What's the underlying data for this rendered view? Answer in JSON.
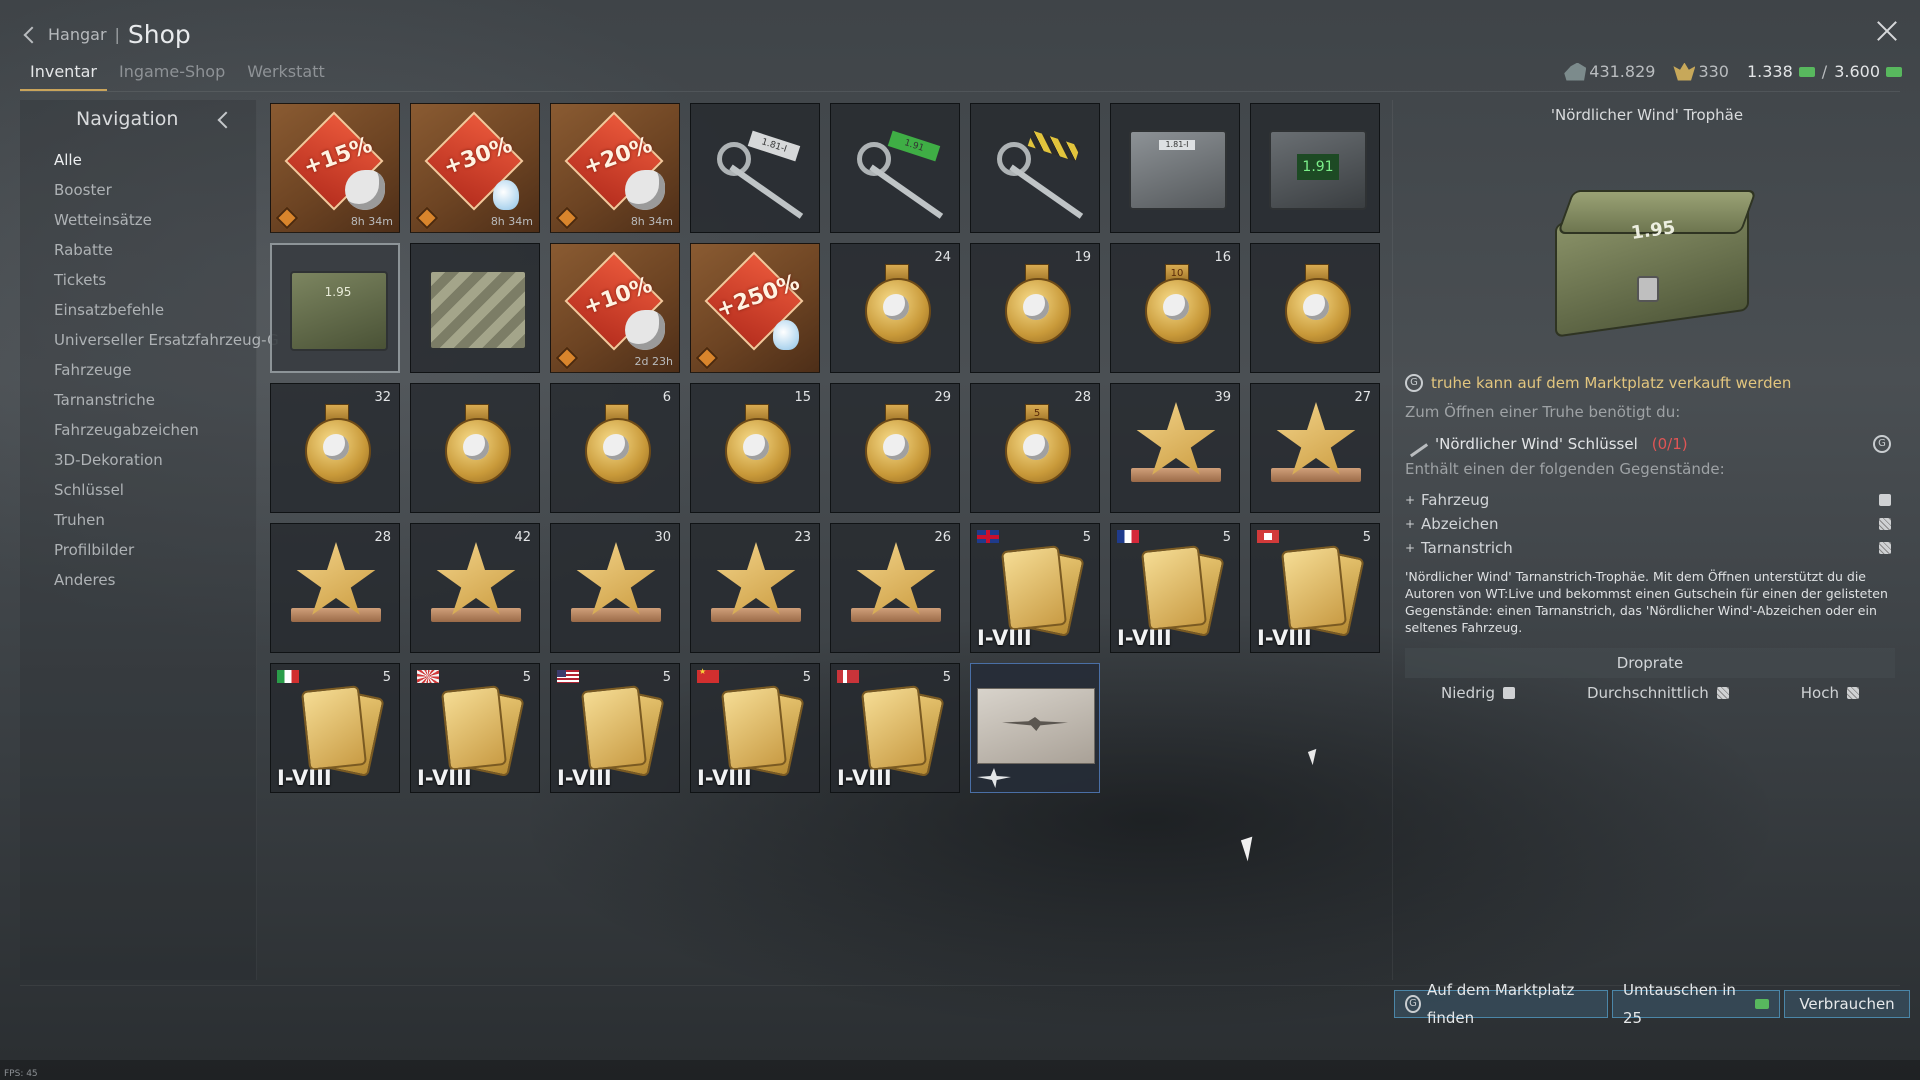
{
  "header": {
    "back_label": "Hangar",
    "separator": "|",
    "title": "Shop",
    "tabs": [
      {
        "label": "Inventar",
        "active": true
      },
      {
        "label": "Ingame-Shop",
        "active": false
      },
      {
        "label": "Werkstatt",
        "active": false
      }
    ]
  },
  "currency": {
    "silver_lions": "431.829",
    "eagles": "330",
    "ge_current": "1.338",
    "ge_separator": "/",
    "ge_total": "3.600"
  },
  "navigation": {
    "title": "Navigation",
    "items": [
      "Alle",
      "Booster",
      "Wetteinsätze",
      "Rabatte",
      "Tickets",
      "Einsatzbefehle",
      "Universeller Ersatzfahrzeug-G",
      "Fahrzeuge",
      "Tarnanstriche",
      "Fahrzeugabzeichen",
      "3D-Dekoration",
      "Schlüssel",
      "Truhen",
      "Profilbilder",
      "Anderes"
    ],
    "active_item": "Alle"
  },
  "inventory": {
    "row1": [
      {
        "type": "booster",
        "percent": "+15%",
        "icon": "lion-icon",
        "timer": "8h 34m"
      },
      {
        "type": "booster",
        "percent": "+30%",
        "icon": "bulb-icon",
        "timer": "8h 34m"
      },
      {
        "type": "booster",
        "percent": "+20%",
        "icon": "lion-icon",
        "timer": "8h 34m"
      },
      {
        "type": "key",
        "tag": "1.81-I",
        "style": "plain"
      },
      {
        "type": "key",
        "tag": "1.91",
        "style": "green"
      },
      {
        "type": "key",
        "tag": "",
        "style": "stripe"
      },
      {
        "type": "crate",
        "label": "1.81-I",
        "style": "grey"
      },
      {
        "type": "crate",
        "label": "1.91",
        "style": "dark"
      }
    ],
    "row2": [
      {
        "type": "crate",
        "label": "1.95",
        "style": "green",
        "selected": true
      },
      {
        "type": "crate",
        "label": "",
        "style": "camo"
      },
      {
        "type": "booster",
        "percent": "+10%",
        "icon": "lion-icon",
        "timer": "2d 23h"
      },
      {
        "type": "booster",
        "percent": "+250%",
        "icon": "bulb-icon",
        "timer": ""
      },
      {
        "type": "medal",
        "count": "24"
      },
      {
        "type": "medal",
        "count": "19"
      },
      {
        "type": "medal",
        "count": "16",
        "ribbon": "10"
      },
      {
        "type": "medal",
        "count": ""
      }
    ],
    "row3": [
      {
        "type": "medal",
        "count": "32"
      },
      {
        "type": "medal",
        "count": ""
      },
      {
        "type": "medal",
        "count": "6"
      },
      {
        "type": "medal",
        "count": "15"
      },
      {
        "type": "medal",
        "count": "29"
      },
      {
        "type": "medal",
        "count": "28",
        "ribbon": "5"
      },
      {
        "type": "star",
        "count": "39"
      },
      {
        "type": "star",
        "count": "27"
      }
    ],
    "row4": [
      {
        "type": "star",
        "count": "28"
      },
      {
        "type": "star",
        "count": "42"
      },
      {
        "type": "star",
        "count": "30"
      },
      {
        "type": "star",
        "count": "23"
      },
      {
        "type": "star",
        "count": "26"
      },
      {
        "type": "cards",
        "count": "5",
        "flag": "uk",
        "rank": "I-VIII"
      },
      {
        "type": "cards",
        "count": "5",
        "flag": "fr",
        "rank": "I-VIII"
      },
      {
        "type": "cards",
        "count": "5",
        "flag": "de",
        "rank": "I-VIII"
      }
    ],
    "row5": [
      {
        "type": "cards",
        "count": "5",
        "flag": "it",
        "rank": "I-VIII"
      },
      {
        "type": "cards",
        "count": "5",
        "flag": "jp",
        "rank": "I-VIII"
      },
      {
        "type": "cards",
        "count": "5",
        "flag": "us",
        "rank": "I-VIII"
      },
      {
        "type": "cards",
        "count": "5",
        "flag": "cn",
        "rank": "I-VIII"
      },
      {
        "type": "cards",
        "count": "5",
        "flag": "nw",
        "rank": "I-VIII"
      },
      {
        "type": "photo",
        "count": "",
        "selected": true
      }
    ]
  },
  "detail": {
    "title": "'Nördlicher Wind' Trophäe",
    "crate_label": "1.95",
    "marketplace_note": "truhe kann auf dem Marktplatz verkauft werden",
    "need_label": "Zum Öffnen einer Truhe benötigt du:",
    "key_name": "'Nördlicher Wind' Schlüssel",
    "key_count": "(0/1)",
    "contains_label": "Enthält einen der folgenden Gegenstände:",
    "items": [
      "Fahrzeug",
      "Abzeichen",
      "Tarnanstrich"
    ],
    "description": "'Nördlicher Wind' Tarnanstrich-Trophäe. Mit dem Öffnen unterstützt du die Autoren von WT:Live und bekommst einen Gutschein für einen der gelisteten Gegenstände: einen Tarnanstrich, das 'Nördlicher Wind'-Abzeichen oder ein seltenes Fahrzeug.",
    "droprate_label": "Droprate",
    "rates": [
      "Niedrig",
      "Durchschnittlich",
      "Hoch"
    ]
  },
  "actions": {
    "market_label": "Auf dem Marktplatz finden",
    "exchange_label": "Umtauschen in 25",
    "consume_label": "Verbrauchen"
  },
  "footer": {
    "fps": "FPS: 45"
  },
  "colors": {
    "accent_gold": "#c9a45b",
    "ge_green": "#58b85e",
    "marketplace_gold": "#e2c57e",
    "key_missing_red": "#e05555",
    "action_blue": "#4b86a8"
  }
}
